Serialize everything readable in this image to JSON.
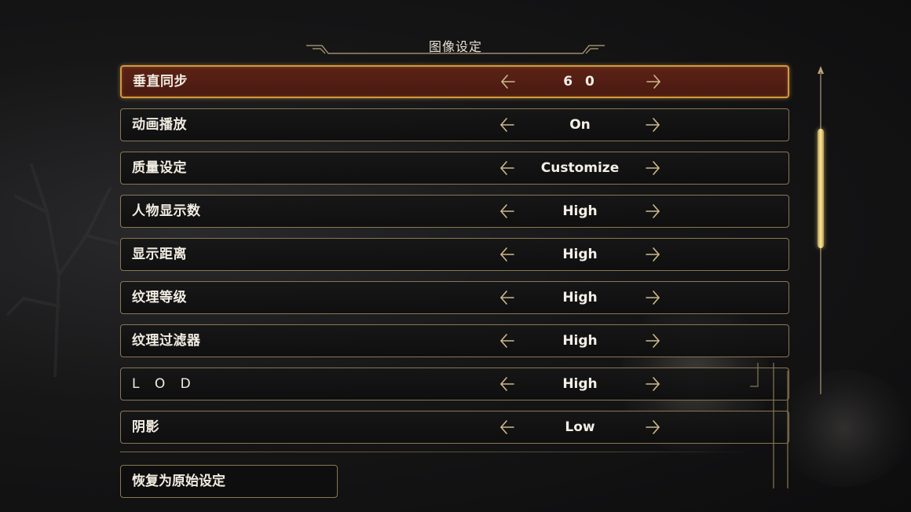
{
  "header": {
    "title": "图像设定"
  },
  "settings": [
    {
      "label": "垂直同步",
      "value": "6 0",
      "selected": true
    },
    {
      "label": "动画播放",
      "value": "On"
    },
    {
      "label": "质量设定",
      "value": "Customize"
    },
    {
      "label": "人物显示数",
      "value": "High"
    },
    {
      "label": "显示距离",
      "value": "High"
    },
    {
      "label": "纹理等级",
      "value": "High"
    },
    {
      "label": "纹理过滤器",
      "value": "High"
    },
    {
      "label": "L O D",
      "value": "High"
    },
    {
      "label": "阴影",
      "value": "Low"
    }
  ],
  "reset_label": "恢复为原始设定",
  "icons": {
    "prev": "arrow-left-icon",
    "next": "arrow-right-icon"
  },
  "colors": {
    "selected_bg": "#5b2216",
    "selected_border": "#d19a3f",
    "row_border": "#8a7752",
    "scroll_thumb": "#fbe9a0"
  },
  "scrollbar": {
    "position_fraction": 0.18,
    "visible_fraction": 0.37
  }
}
